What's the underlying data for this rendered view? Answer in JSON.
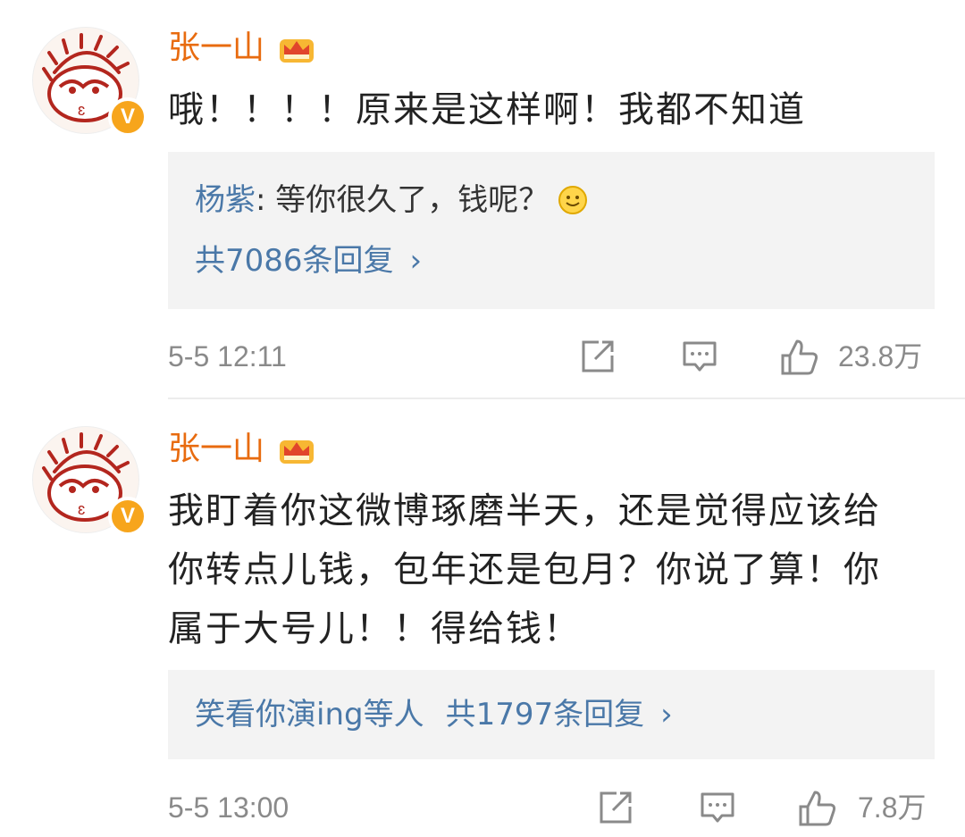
{
  "comments": [
    {
      "author": "张一山",
      "avatar_badge": "V",
      "text_lines": [
        "哦！！！！原来是这样啊！我都不知道"
      ],
      "reply_preview": {
        "user": "杨紫",
        "text": ": 等你很久了，钱呢？",
        "icon": "smile-emoji"
      },
      "reply_count_text": "共7086条回复",
      "time": "5-5 12:11",
      "likes": "23.8万"
    },
    {
      "author": "张一山",
      "avatar_badge": "V",
      "text_lines": [
        "我盯着你这微博琢磨半天，还是觉得应该给",
        "你转点儿钱，包年还是包月？你说了算！你",
        "属于大号儿！！得给钱！"
      ],
      "reply_summary_users": "笑看你演ing等人",
      "reply_count_text": "共1797条回复",
      "time": "5-5 13:00",
      "likes": "7.8万"
    }
  ],
  "icons": {
    "share": "share-icon",
    "comment": "comment-icon",
    "like": "thumbs-up-icon",
    "crown": "crown-badge-icon",
    "chevron": "chevron-right-icon"
  },
  "colors": {
    "name": "#e86b0f",
    "link": "#4a78a8",
    "meta": "#8a8a8a",
    "reply_bg": "#f3f3f3",
    "badge": "#f7a51c"
  }
}
